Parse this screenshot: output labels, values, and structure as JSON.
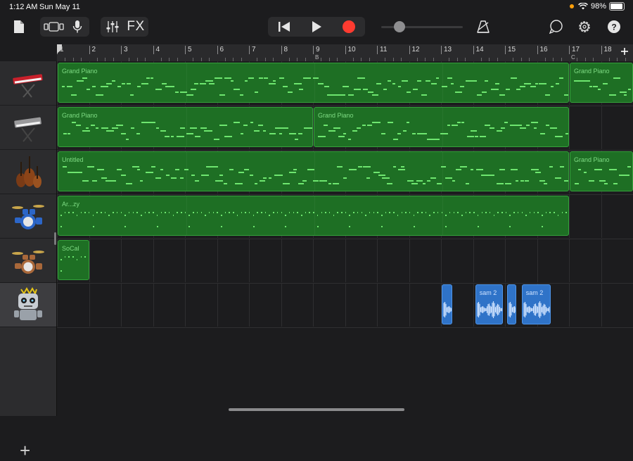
{
  "status": {
    "time": "1:12 AM",
    "date": "Sun May 11",
    "battery": "98%"
  },
  "toolbar": {
    "fx_label": "FX",
    "colors": {
      "record": "#ff3b30",
      "icon": "#e5e5e5"
    }
  },
  "ruler": {
    "bars": [
      "1",
      "2",
      "3",
      "4",
      "5",
      "6",
      "7",
      "8",
      "9",
      "10",
      "11",
      "12",
      "13",
      "14",
      "15",
      "16",
      "17",
      "18"
    ],
    "markers": [
      {
        "bar": "9",
        "label": "B"
      },
      {
        "bar": "17",
        "label": "C"
      }
    ]
  },
  "tracks": [
    {
      "instrument": "keyboard-red",
      "regions": [
        {
          "label": "Grand Piano",
          "type": "midi"
        },
        {
          "label": "Grand Piano",
          "type": "midi"
        }
      ]
    },
    {
      "instrument": "keyboard-grey",
      "regions": [
        {
          "label": "Grand Piano",
          "type": "midi"
        },
        {
          "label": "Grand Piano",
          "type": "midi"
        }
      ]
    },
    {
      "instrument": "strings",
      "regions": [
        {
          "label": "Untitled",
          "type": "midi"
        },
        {
          "label": "Grand Piano",
          "type": "midi"
        }
      ]
    },
    {
      "instrument": "drum-kit-blue",
      "regions": [
        {
          "label": "Ar...zy",
          "type": "drums"
        }
      ]
    },
    {
      "instrument": "drum-kit-wood",
      "regions": [
        {
          "label": "SoCal",
          "type": "drums"
        }
      ]
    },
    {
      "instrument": "robot",
      "regions": [
        {
          "label": "",
          "type": "audio"
        },
        {
          "label": "sam 2",
          "type": "audio"
        },
        {
          "label": "",
          "type": "audio"
        },
        {
          "label": "sam 2",
          "type": "audio"
        }
      ]
    }
  ],
  "add_track_label": "+"
}
